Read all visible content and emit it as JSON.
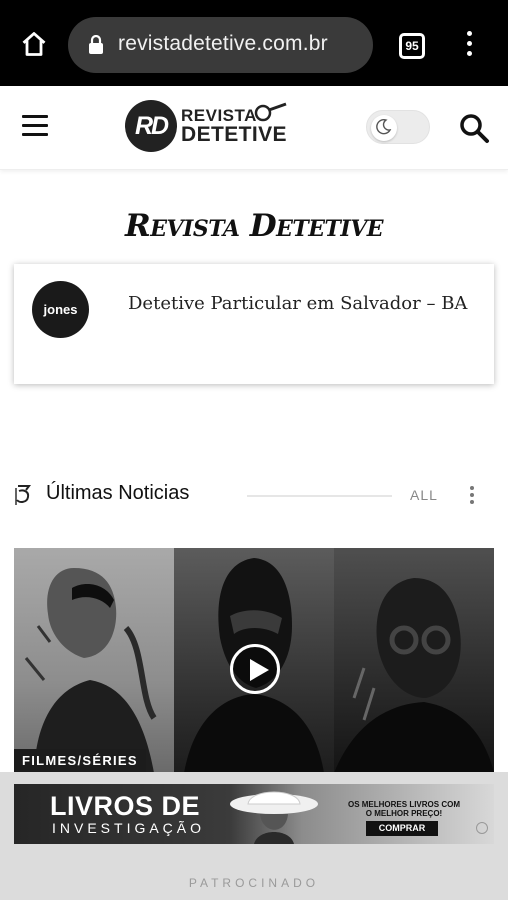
{
  "browser": {
    "url": "revistadetetive.com.br",
    "tab_count": "95"
  },
  "header": {
    "logo_monogram": "RD",
    "logo_line1": "REVISTA",
    "logo_line2": "DETETIVE"
  },
  "page": {
    "site_title": "Revista Detetive"
  },
  "card": {
    "avatar_text": "jones",
    "text": "Detetive Particular em Salvador – BA"
  },
  "section": {
    "title": "Últimas Noticias",
    "all_label": "ALL"
  },
  "featured": {
    "category": "FILMES/SÉRIES"
  },
  "ad": {
    "title": "LIVROS DE",
    "subtitle": "INVESTIGAÇÃO",
    "tagline": "OS MELHORES LIVROS COM O MELHOR PREÇO!",
    "cta": "COMPRAR",
    "sponsored_label": "PATROCINADO"
  }
}
